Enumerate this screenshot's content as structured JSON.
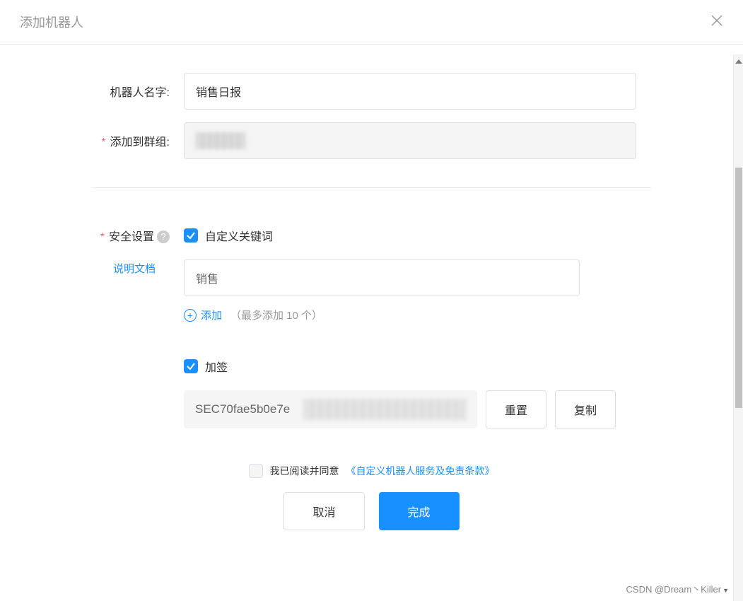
{
  "header": {
    "title": "添加机器人"
  },
  "form": {
    "robot_name_label": "机器人名字:",
    "robot_name_value": "销售日报",
    "group_label": "添加到群组:",
    "security_label": "安全设置",
    "doc_link": "说明文档",
    "custom_keyword_label": "自定义关键词",
    "keyword_value": "销售",
    "add_label": "添加",
    "add_hint": "（最多添加 10 个）",
    "sign_label": "加签",
    "secret_value": "SEC70fae5b0e7e",
    "reset_button": "重置",
    "copy_button": "复制"
  },
  "footer": {
    "agree_text": "我已阅读并同意",
    "agree_link": "《自定义机器人服务及免责条款》",
    "cancel_button": "取消",
    "confirm_button": "完成"
  },
  "watermark": "CSDN @Dream丶Killer"
}
